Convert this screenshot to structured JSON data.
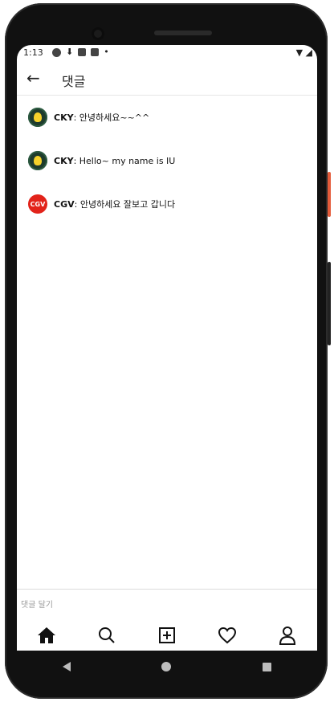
{
  "status_bar": {
    "time": "1:13"
  },
  "header": {
    "title": "댓글"
  },
  "comments": [
    {
      "user": "CKY",
      "text": ": 안녕하세요~~^^"
    },
    {
      "user": "CKY",
      "text": ": Hello~ my name is IU"
    },
    {
      "user": "CGV",
      "text": ": 안녕하세요 잘보고 갑니다",
      "avatar_label": "CGV"
    }
  ],
  "comment_input": {
    "placeholder": "댓글 달기"
  },
  "colors": {
    "cgv_red": "#e2231a",
    "accent_side_button": "#e45b3a"
  }
}
